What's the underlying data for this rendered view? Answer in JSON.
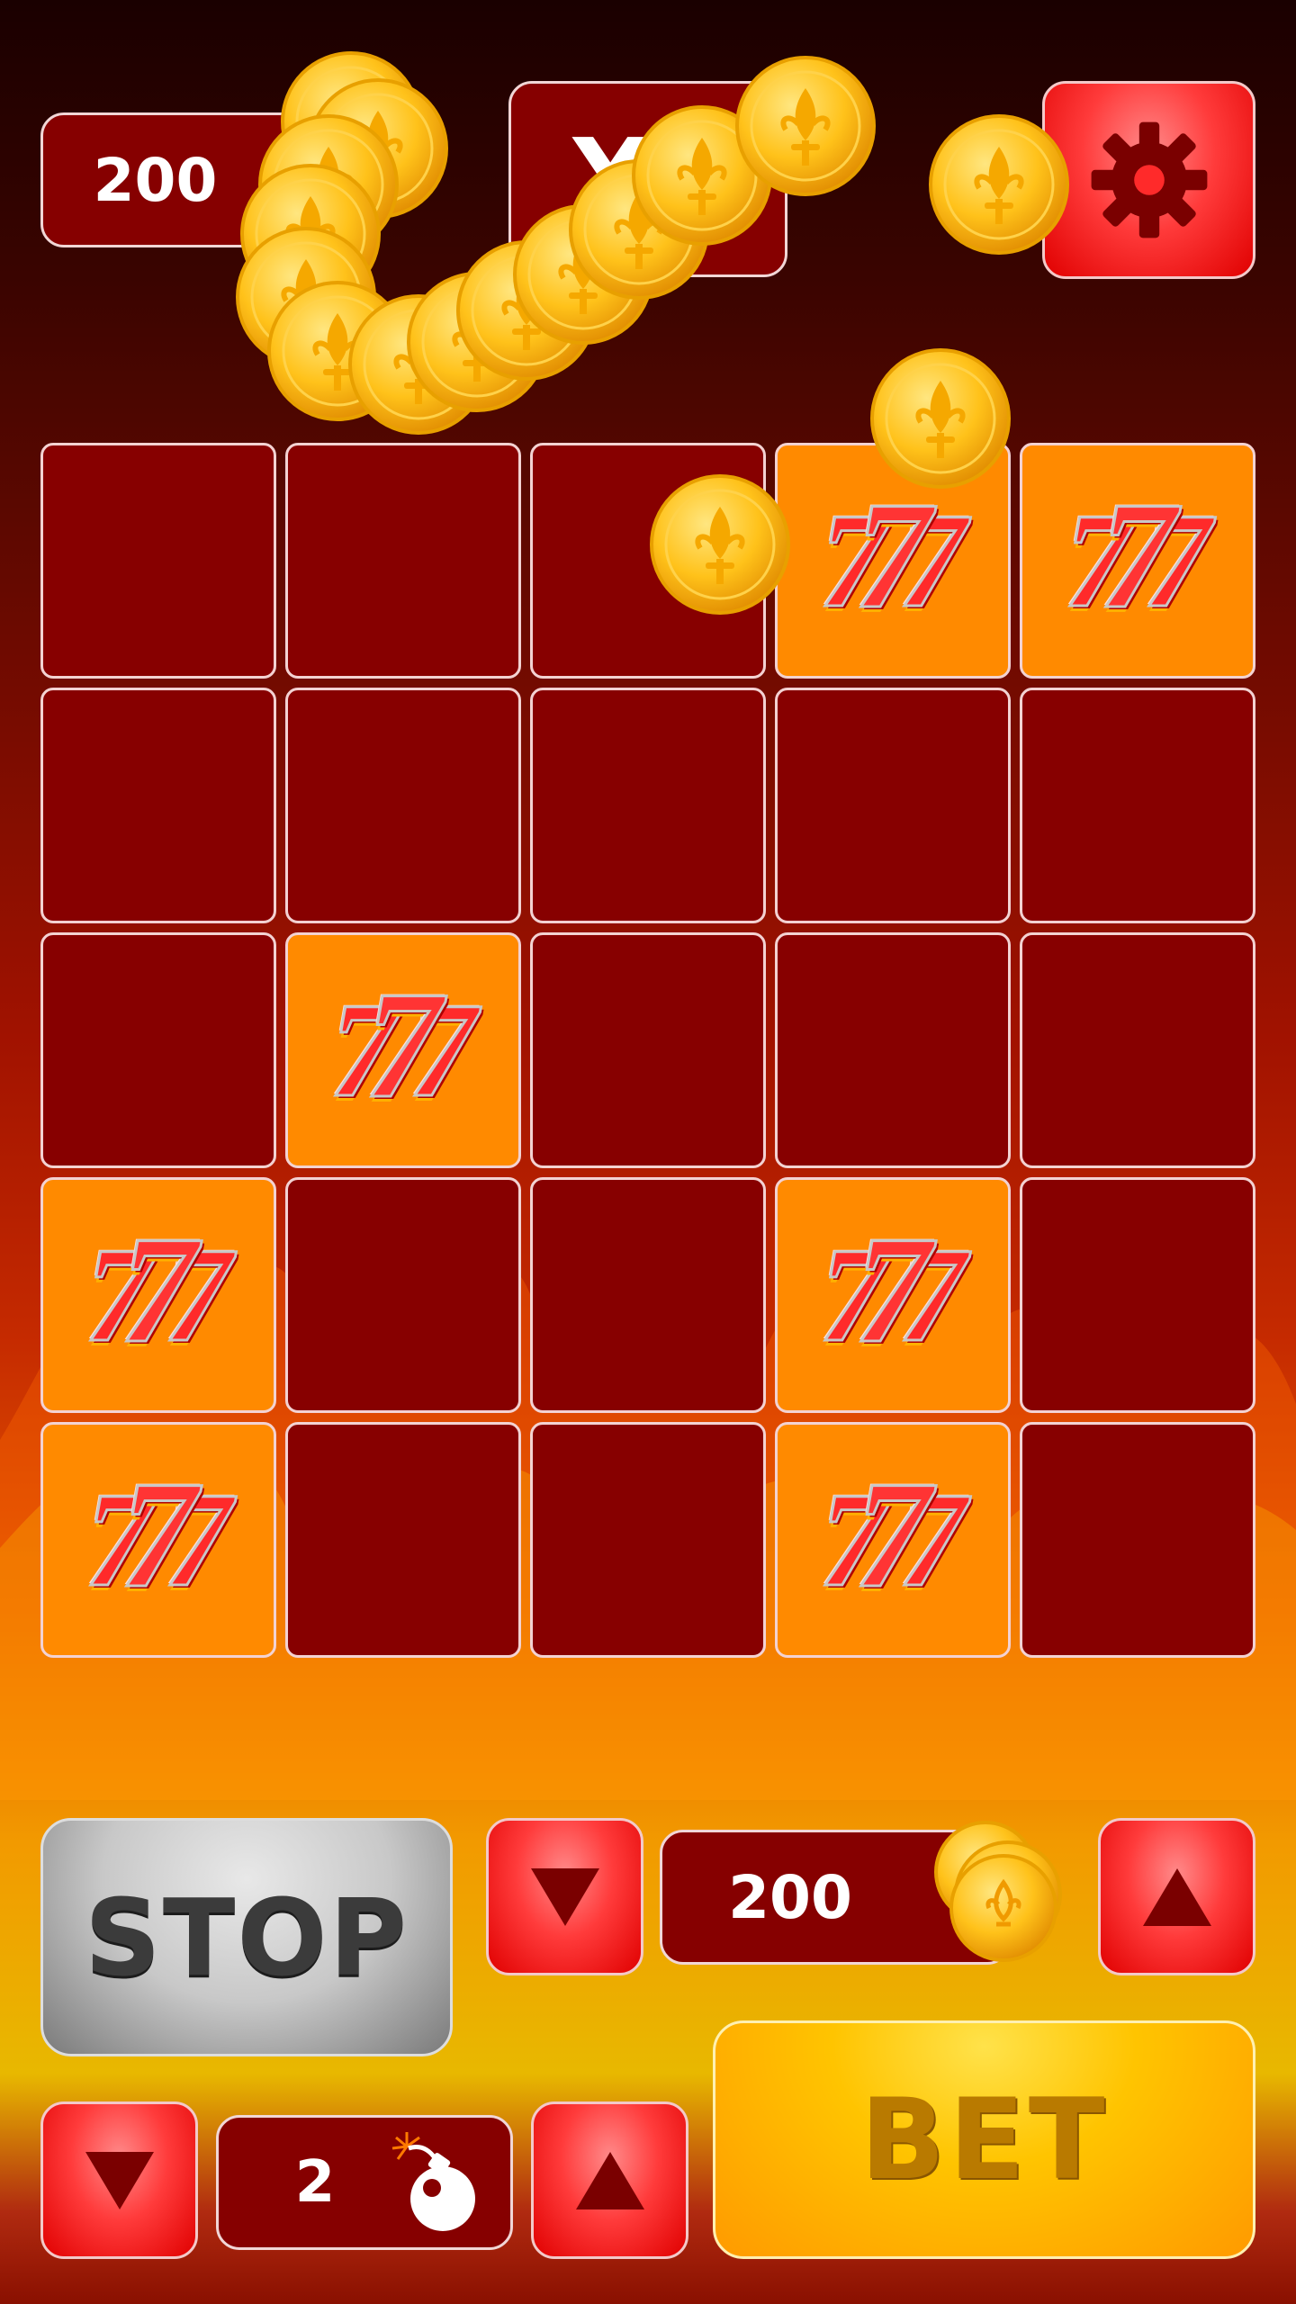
{
  "header": {
    "balance": "200",
    "multiplier": "X2",
    "settings_icon": "gear-icon"
  },
  "grid": {
    "rows": 5,
    "cols": 5,
    "symbol_text": "777",
    "revealed_cells": [
      [
        0,
        3
      ],
      [
        0,
        4
      ],
      [
        2,
        1
      ],
      [
        3,
        0
      ],
      [
        3,
        3
      ],
      [
        4,
        0
      ],
      [
        4,
        3
      ]
    ]
  },
  "controls": {
    "stop_label": "STOP",
    "bet_label": "BET",
    "bet_amount": "200",
    "mines_count": "2",
    "mine_icon": "bomb-icon",
    "coin_icon": "coin-icon"
  },
  "colors": {
    "cell_hidden": "#870000",
    "cell_revealed": "#ff8a00",
    "button_red": "#ff3b3b",
    "bet_yellow": "#ffc400",
    "stop_gray": "#c8c8c8"
  }
}
